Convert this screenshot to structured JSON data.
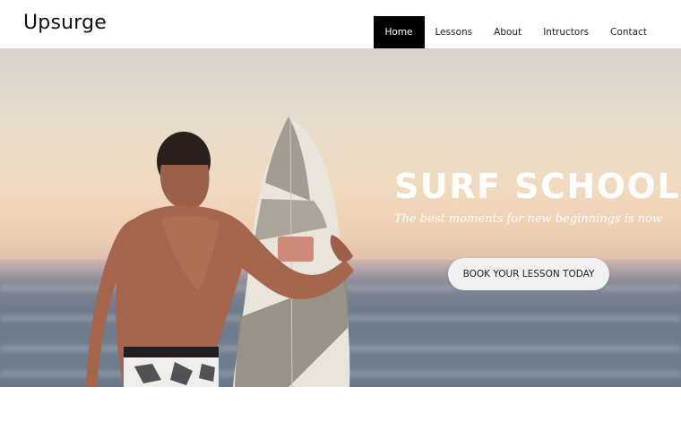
{
  "header": {
    "logo": "Upsurge",
    "nav": [
      {
        "label": "Home",
        "active": true
      },
      {
        "label": "Lessons",
        "active": false
      },
      {
        "label": "About",
        "active": false
      },
      {
        "label": "Intructors",
        "active": false
      },
      {
        "label": "Contact",
        "active": false
      }
    ]
  },
  "hero": {
    "title": "SURF SCHOOL",
    "subtitle": "The best moments for new beginnings is now",
    "cta_label": "BOOK YOUR LESSON TODAY",
    "image": "surfer-holding-surfboard-at-beach"
  },
  "colors": {
    "active_nav_bg": "#000000",
    "cta_bg": "#f1f1f3"
  }
}
